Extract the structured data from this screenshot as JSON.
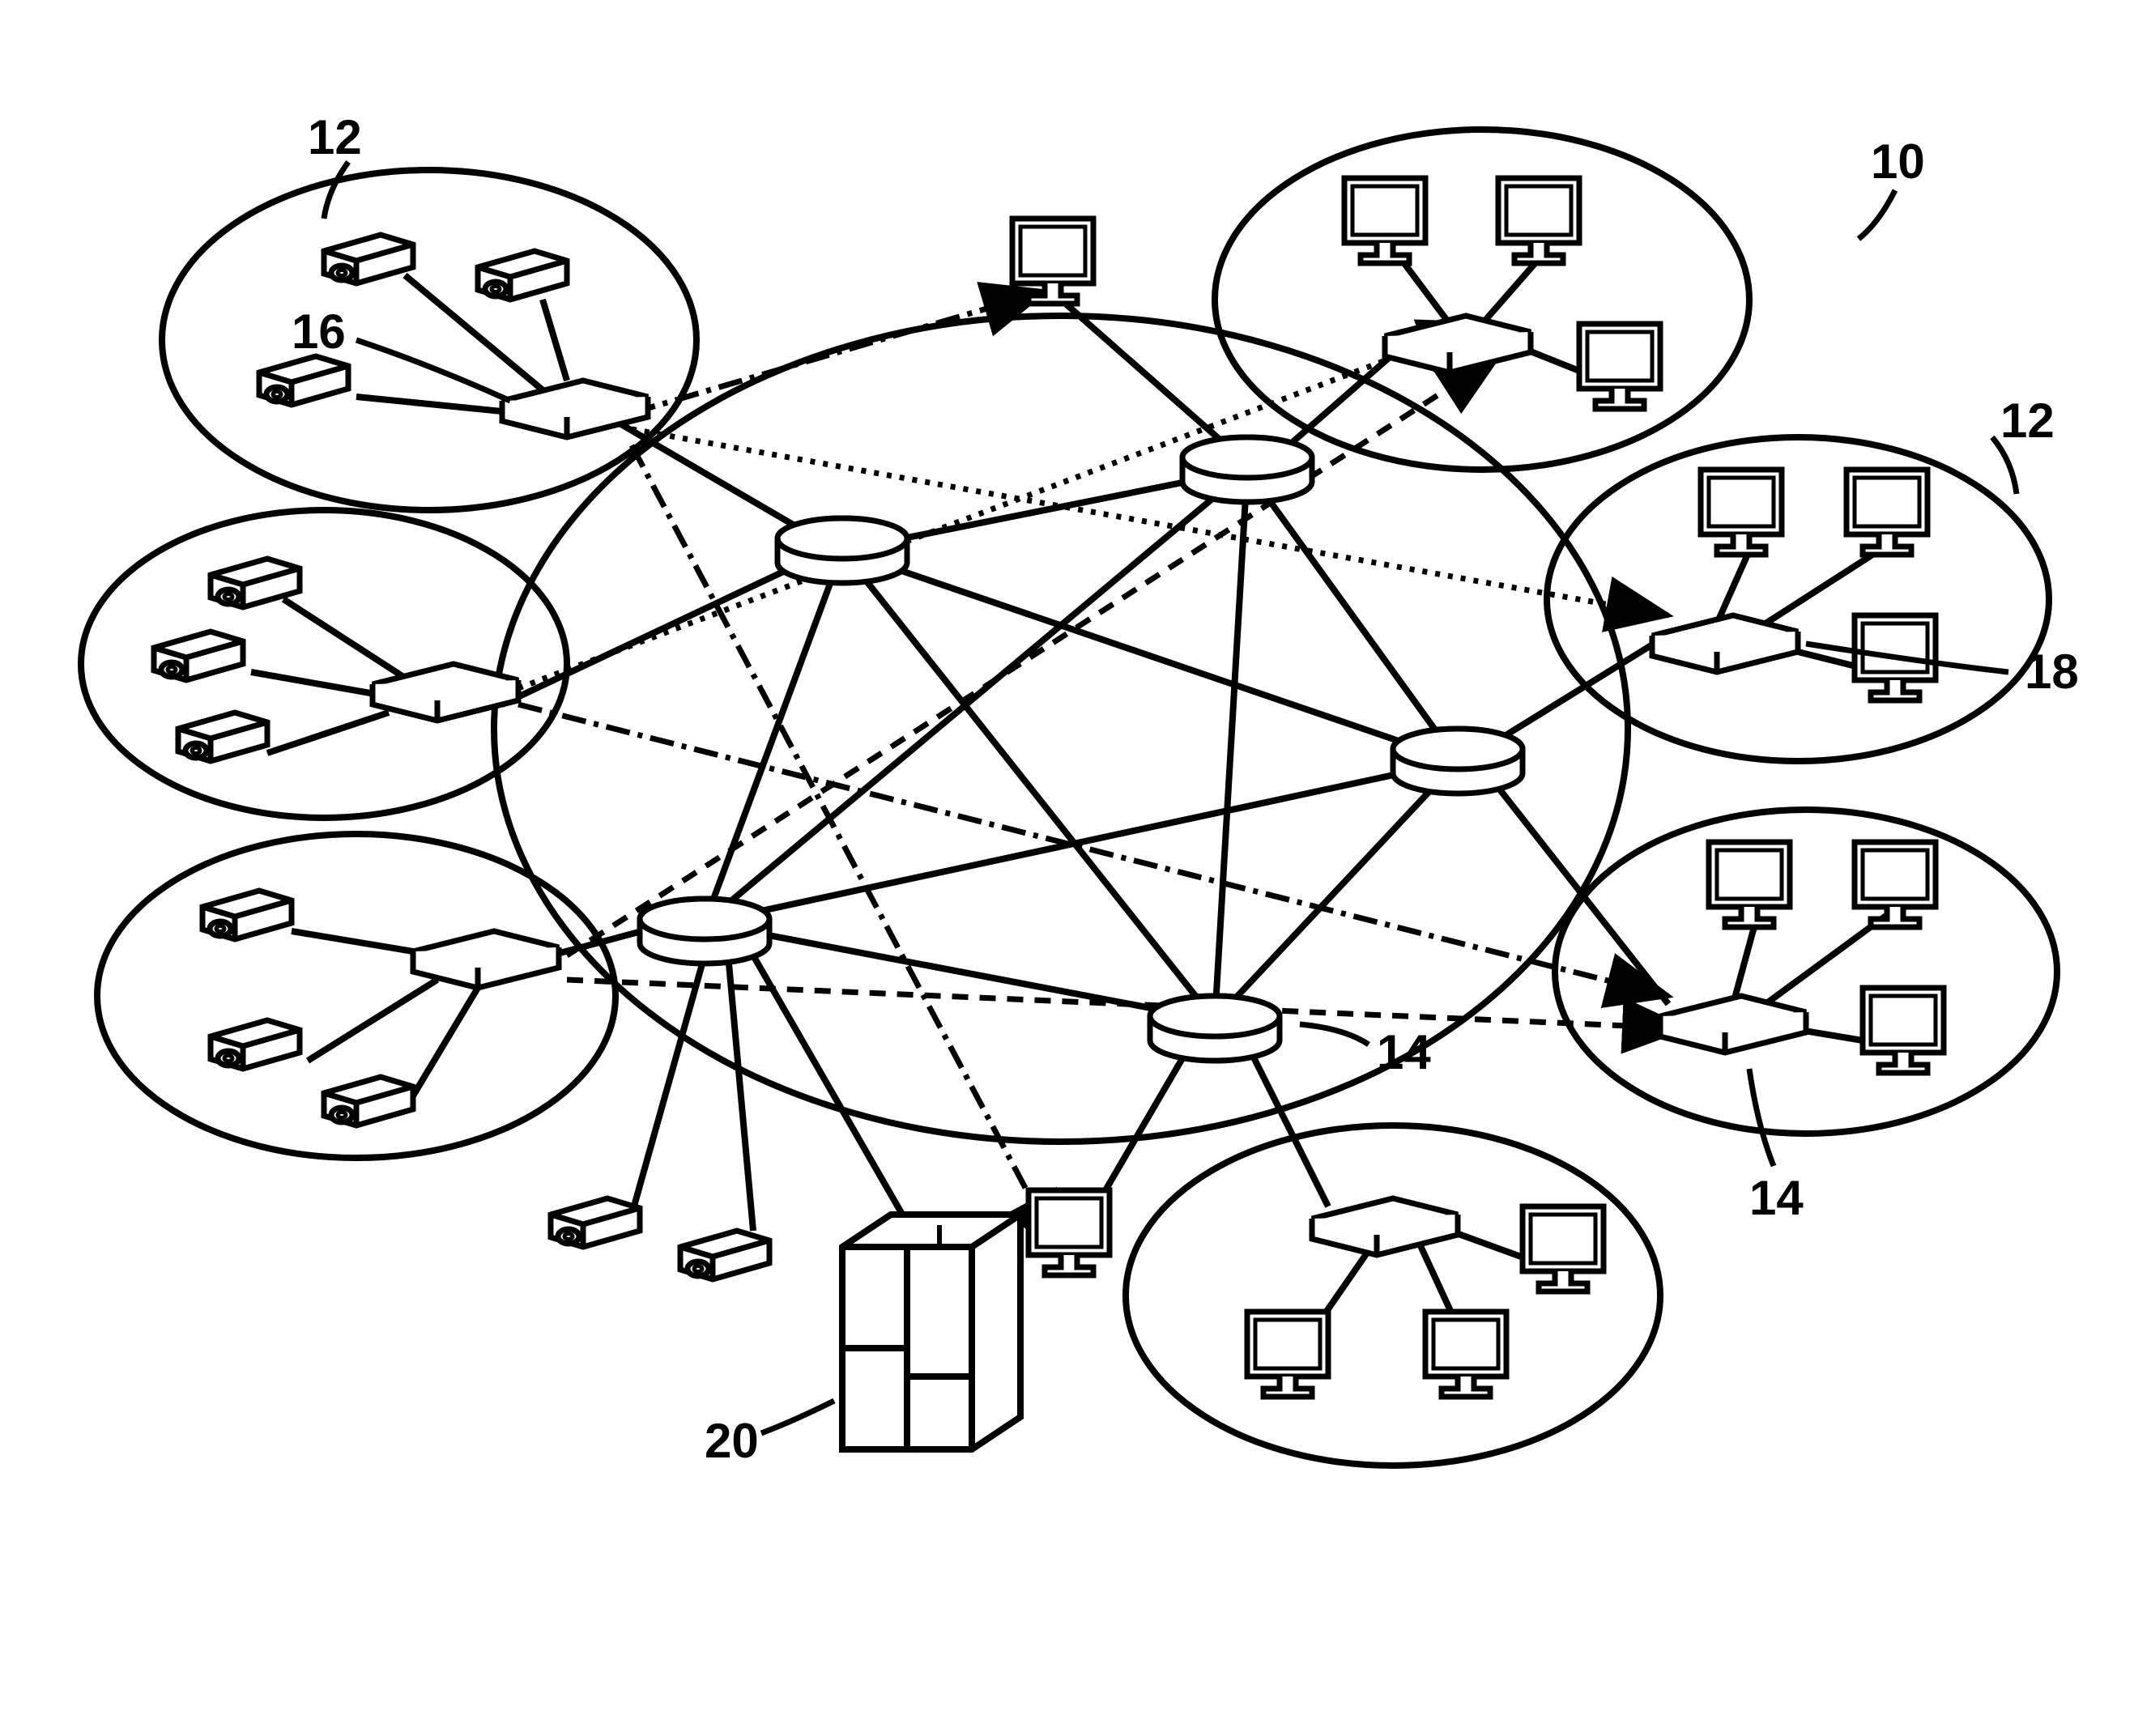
{
  "diagram": {
    "reference_numbers": {
      "system": "10",
      "source_groups": "12",
      "network_routers_inner": "14",
      "network_routers_outer": "14",
      "source_switch": "16",
      "destination_switch": "18",
      "server": "20"
    },
    "description": "Network topology diagram showing source camera groups connected through a central mesh network of routers to destination computer groups, with a server attached",
    "components": {
      "source_groups_count": 3,
      "cameras_per_group": 3,
      "destination_groups_count": 4,
      "computers_per_group": 3,
      "routers_count": 5,
      "standalone_cameras": 2,
      "standalone_computers": 2,
      "servers": 1
    }
  }
}
